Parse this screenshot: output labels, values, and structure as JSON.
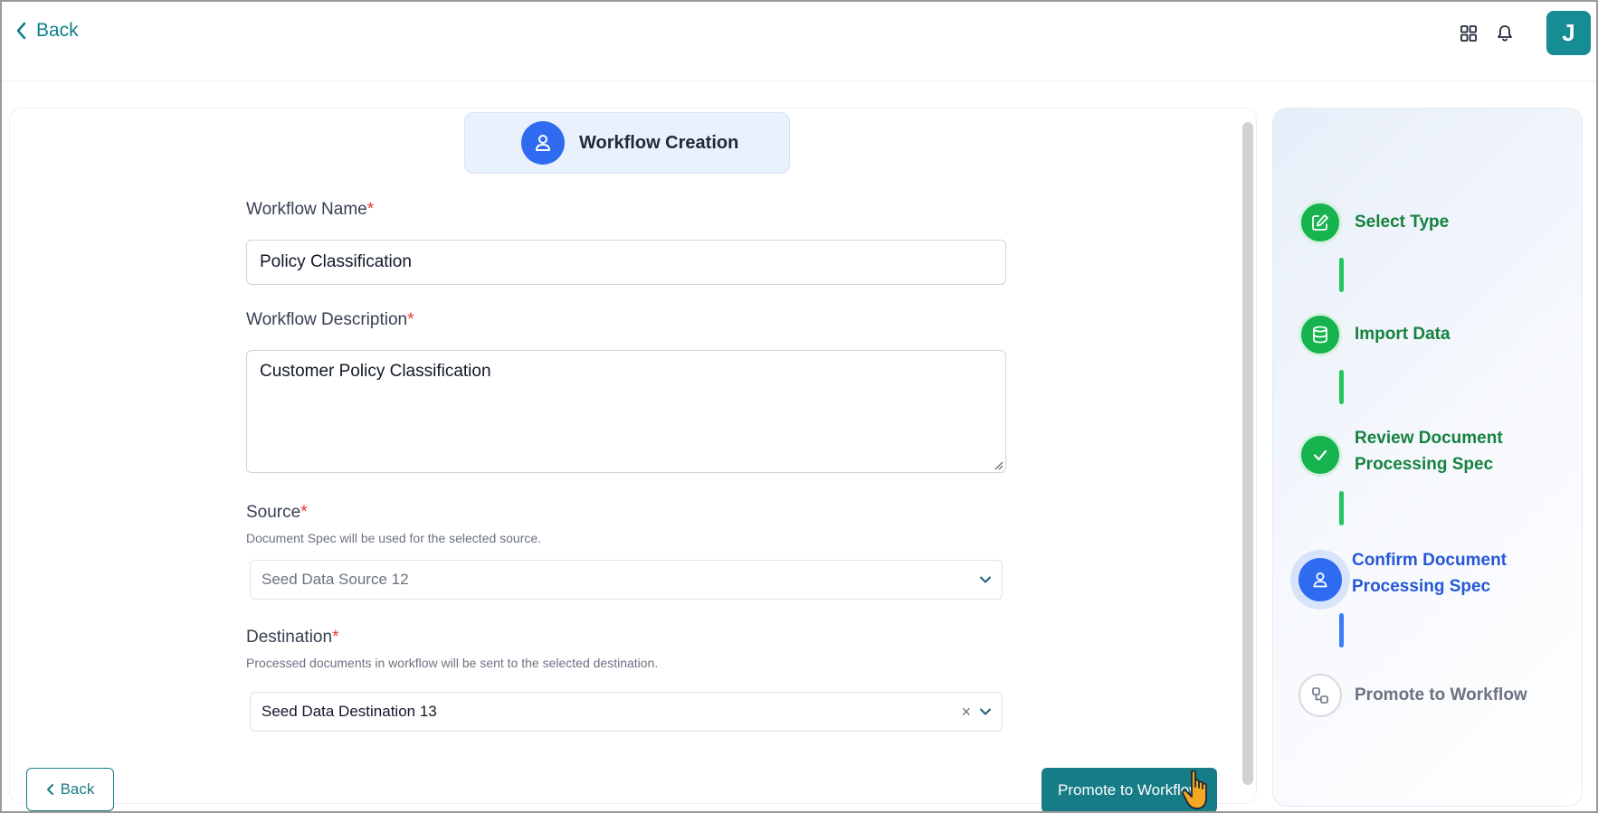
{
  "header": {
    "back_label": "Back",
    "avatar_initial": "J",
    "icons": [
      "apps-grid-icon",
      "bell-icon"
    ]
  },
  "form": {
    "section_title": "Workflow Creation",
    "workflow_name": {
      "label": "Workflow Name",
      "required_mark": "*",
      "value": "Policy Classification"
    },
    "workflow_description": {
      "label": "Workflow Description",
      "required_mark": "*",
      "value": "Customer Policy Classification"
    },
    "source": {
      "label": "Source",
      "required_mark": "*",
      "hint": "Document Spec will be used for the selected source.",
      "placeholder": "Seed Data Source 12"
    },
    "destination": {
      "label": "Destination",
      "required_mark": "*",
      "hint": "Processed documents in workflow will be sent to the selected destination.",
      "value": "Seed Data Destination 13",
      "clear_symbol": "×"
    }
  },
  "footer": {
    "back_label": "Back",
    "promote_label": "Promote to Workflow"
  },
  "steps": [
    {
      "label_lines": [
        "Select Type"
      ],
      "status": "done",
      "icon": "edit-icon"
    },
    {
      "label_lines": [
        "Import Data"
      ],
      "status": "done",
      "icon": "database-icon"
    },
    {
      "label_lines": [
        "Review Document",
        "Processing Spec"
      ],
      "status": "done",
      "icon": "check-icon"
    },
    {
      "label_lines": [
        "Confirm Document",
        "Processing Spec"
      ],
      "status": "active",
      "icon": "user-icon"
    },
    {
      "label_lines": [
        "Promote to Workflow"
      ],
      "status": "pending",
      "icon": "workflow-icon"
    }
  ],
  "colors": {
    "teal": "#167c86",
    "green": "#16b34f",
    "blue": "#2f6bf0",
    "required": "#e53935"
  }
}
